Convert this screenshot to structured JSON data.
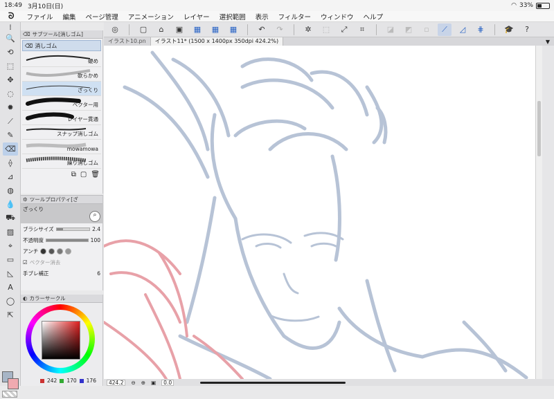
{
  "statusbar": {
    "time": "18:49",
    "date": "3月10日(日)",
    "battery": "33%"
  },
  "menu": [
    "ファイル",
    "編集",
    "ページ管理",
    "アニメーション",
    "レイヤー",
    "選択範囲",
    "表示",
    "フィルター",
    "ウィンドウ",
    "ヘルプ"
  ],
  "tabs": {
    "tab1": "イラスト10.pn",
    "tab2": "イラスト11* (1500 x 1400px 350dpi 424.2%)"
  },
  "subtool": {
    "title": "サブツール[消しゴム]",
    "category": "消しゴム",
    "brushes": [
      {
        "label": "硬め"
      },
      {
        "label": "軟らかめ"
      },
      {
        "label": "ざっくり"
      },
      {
        "label": "ベクター用"
      },
      {
        "label": "レイヤー貫通"
      },
      {
        "label": "スナップ消しゴム"
      },
      {
        "label": "mowamowa"
      },
      {
        "label": "繰り消しゴム"
      }
    ]
  },
  "props": {
    "title": "ツールプロパティ[ざ",
    "preview": "ざっくり",
    "brush_size_label": "ブラシサイズ",
    "brush_size_value": "2.4",
    "opacity_label": "不透明度",
    "opacity_value": "100",
    "aa_label": "アンチ",
    "vector_label": "ベクター消去",
    "stab_label": "手ブレ補正",
    "stab_value": "6"
  },
  "color": {
    "title": "カラーサークル",
    "r": "242",
    "g": "170",
    "b": "176",
    "main_color": "#a7b5c6",
    "sub_color": "#f0aab0"
  },
  "bottom": {
    "zoom": "424.2",
    "angle": "0.0"
  },
  "sketch": {
    "line_color": "#b7c3d6",
    "red_color": "#e8a1a8"
  }
}
